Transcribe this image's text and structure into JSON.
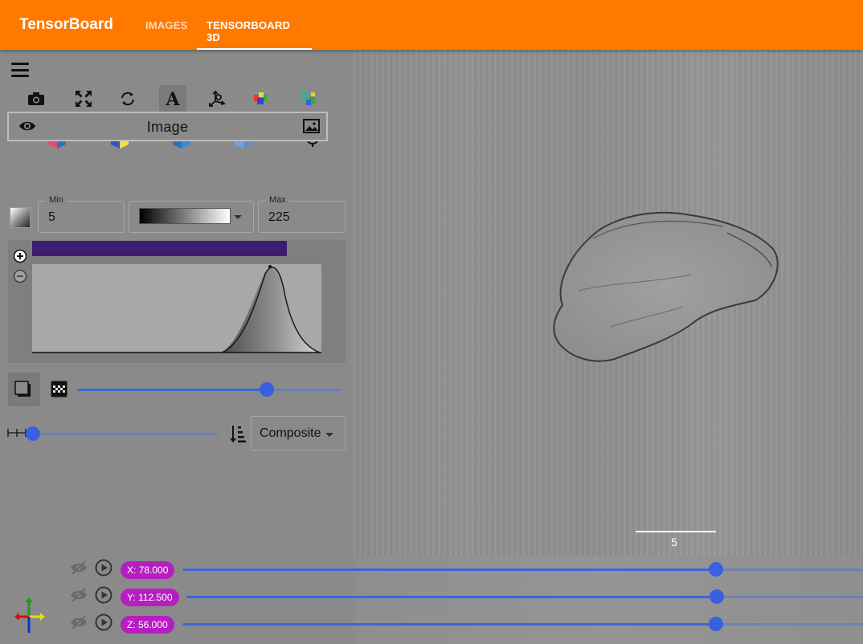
{
  "app": {
    "brand": "TensorBoard",
    "tabs": [
      {
        "label": "IMAGES",
        "active": false
      },
      {
        "label": "TENSORBOARD 3D",
        "active": true
      }
    ],
    "accent_color": "#ff7800"
  },
  "toolbar": {
    "row1_icons": [
      "camera-icon",
      "fullscreen-icon",
      "rotate-icon",
      "text-annotation-icon",
      "axes-icon",
      "color-cube-icon",
      "layers-icon"
    ],
    "row2_icons": [
      "red-blue-cube-icon",
      "blue-yellow-cube-icon",
      "green-blue-cube-icon",
      "light-blue-cube-icon",
      "crosshair-icon"
    ],
    "selected_icon": "text-annotation-icon"
  },
  "layer": {
    "name": "Image",
    "visible": true
  },
  "window_level": {
    "min_label": "Min",
    "min_value": "5",
    "max_label": "Max",
    "max_value": "225",
    "colormap": "grayscale",
    "colormap_bar_color": "#3d1d70"
  },
  "histogram": {
    "opacity_bar_color": "#3d1d70"
  },
  "opacity_slider": {
    "value": 0.73
  },
  "sample_slider": {
    "value": 0.0
  },
  "blend_mode": {
    "selected": "Composite"
  },
  "scale_bar": {
    "label": "5"
  },
  "slices": [
    {
      "axis": "X",
      "label": "X: 78.000",
      "position": 0.79
    },
    {
      "axis": "Y",
      "label": "Y: 112.500",
      "position": 0.79
    },
    {
      "axis": "Z",
      "label": "Z: 56.000",
      "position": 0.79
    }
  ],
  "slice_pill_color": "#b51ec1"
}
